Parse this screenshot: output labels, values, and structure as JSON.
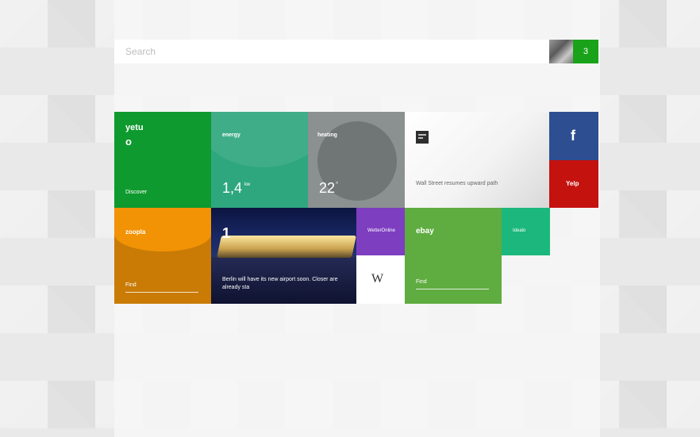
{
  "search": {
    "placeholder": "Search"
  },
  "user": {
    "notification_count": "3"
  },
  "tiles": {
    "yetu": {
      "title": "yetu",
      "glyph": "o",
      "action": "Discover"
    },
    "energy": {
      "title": "energy",
      "value": "1,4",
      "unit": "kw"
    },
    "heating": {
      "title": "heating",
      "value": "22",
      "unit": "°"
    },
    "news": {
      "icon": "news-icon",
      "headline": "Wall Street resumes upward path"
    },
    "facebook": {
      "glyph": "f"
    },
    "yelp": {
      "label": "Yelp"
    },
    "zoopla": {
      "title": "zoopla",
      "action": "Find"
    },
    "berlin": {
      "logo": "1",
      "caption": "Berlin will have its new airport soon. Closer are already sta"
    },
    "wetter": {
      "label": "WetterOnline"
    },
    "wikipedia": {
      "glyph": "W"
    },
    "ebay": {
      "title": "ebay",
      "action": "Find"
    },
    "green_small": {
      "label": "Idealo"
    }
  },
  "colors": {
    "yetu": "#0e9a2e",
    "energy": "#2fa77e",
    "heating": "#8a9190",
    "facebook": "#2d4f91",
    "yelp": "#c4120f",
    "zoopla": "#f29205",
    "wetter": "#7e3ec0",
    "ebay": "#5fac40",
    "notif": "#1aa31a"
  }
}
